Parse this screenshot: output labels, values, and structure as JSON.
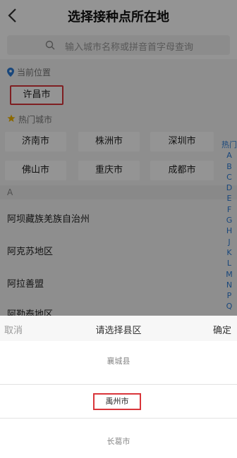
{
  "header": {
    "title": "选择接种点所在地"
  },
  "search": {
    "placeholder": "输入城市名称或拼音首字母查询"
  },
  "current_location": {
    "label": "当前位置",
    "city": "许昌市"
  },
  "hot_cities": {
    "label": "热门城市",
    "items": [
      "济南市",
      "株洲市",
      "深圳市",
      "佛山市",
      "重庆市",
      "成都市"
    ]
  },
  "city_list": {
    "section_letter": "A",
    "items": [
      "阿坝藏族羌族自治州",
      "阿克苏地区",
      "阿拉善盟",
      "阿勒泰地区"
    ]
  },
  "index_bar": [
    "热门",
    "A",
    "B",
    "C",
    "D",
    "E",
    "F",
    "G",
    "H",
    "J",
    "K",
    "L",
    "M",
    "N",
    "P",
    "Q"
  ],
  "picker": {
    "cancel_label": "取消",
    "title": "请选择县区",
    "confirm_label": "确定",
    "options": [
      "襄城县",
      "禹州市",
      "长葛市"
    ],
    "selected": "禹州市"
  },
  "colors": {
    "highlight_border": "#d9353a",
    "index_blue": "#2b7bd6"
  }
}
